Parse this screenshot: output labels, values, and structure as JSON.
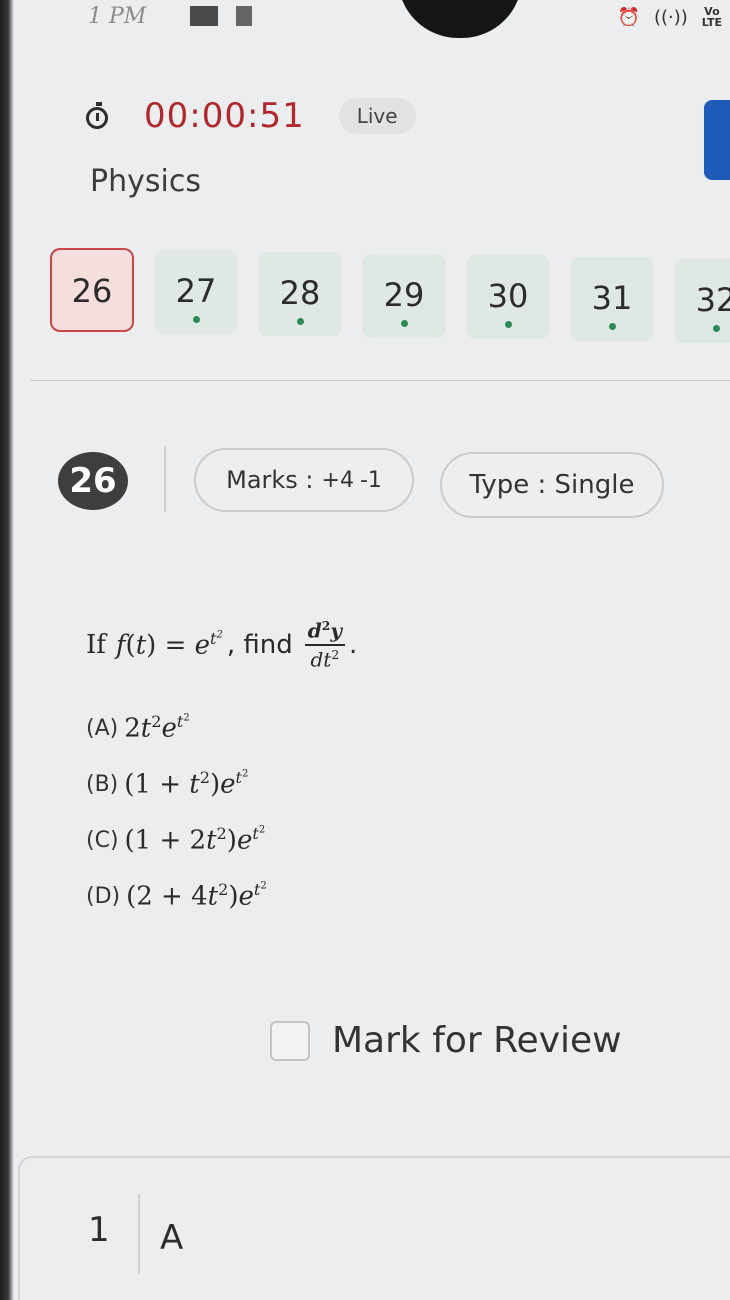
{
  "status_bar": {
    "time": "1 PM",
    "icons": [
      "notification-icon",
      "alarm-icon",
      "hotspot-icon",
      "volte-lte-icon"
    ],
    "hotspot_glyph": "((·))",
    "volte_top": "Vo",
    "volte_bottom": "LTE"
  },
  "header": {
    "timer": "00:00:51",
    "live_label": "Live",
    "subject": "Physics"
  },
  "question_nav": {
    "current": "26",
    "items": [
      "26",
      "27",
      "28",
      "29",
      "30",
      "31",
      "32"
    ]
  },
  "question": {
    "number": "26",
    "marks_label": "Marks :",
    "marks_positive": "+4",
    "marks_negative": "-1",
    "type_label": "Type : Single",
    "lead": "If",
    "find_text": ", find",
    "options": [
      {
        "label": "(A)"
      },
      {
        "label": "(B)"
      },
      {
        "label": "(C)"
      },
      {
        "label": "(D)"
      }
    ]
  },
  "review": {
    "label": "Mark for Review",
    "checked": false
  },
  "answer": {
    "number": "1",
    "value": "A"
  },
  "colors": {
    "timer": "#b0282d",
    "current_border": "#c7474a",
    "current_fill": "#f6dede",
    "attempted_fill": "#dfe8e2",
    "dot": "#2b8a55",
    "accent_tab": "#1f5bb8"
  }
}
